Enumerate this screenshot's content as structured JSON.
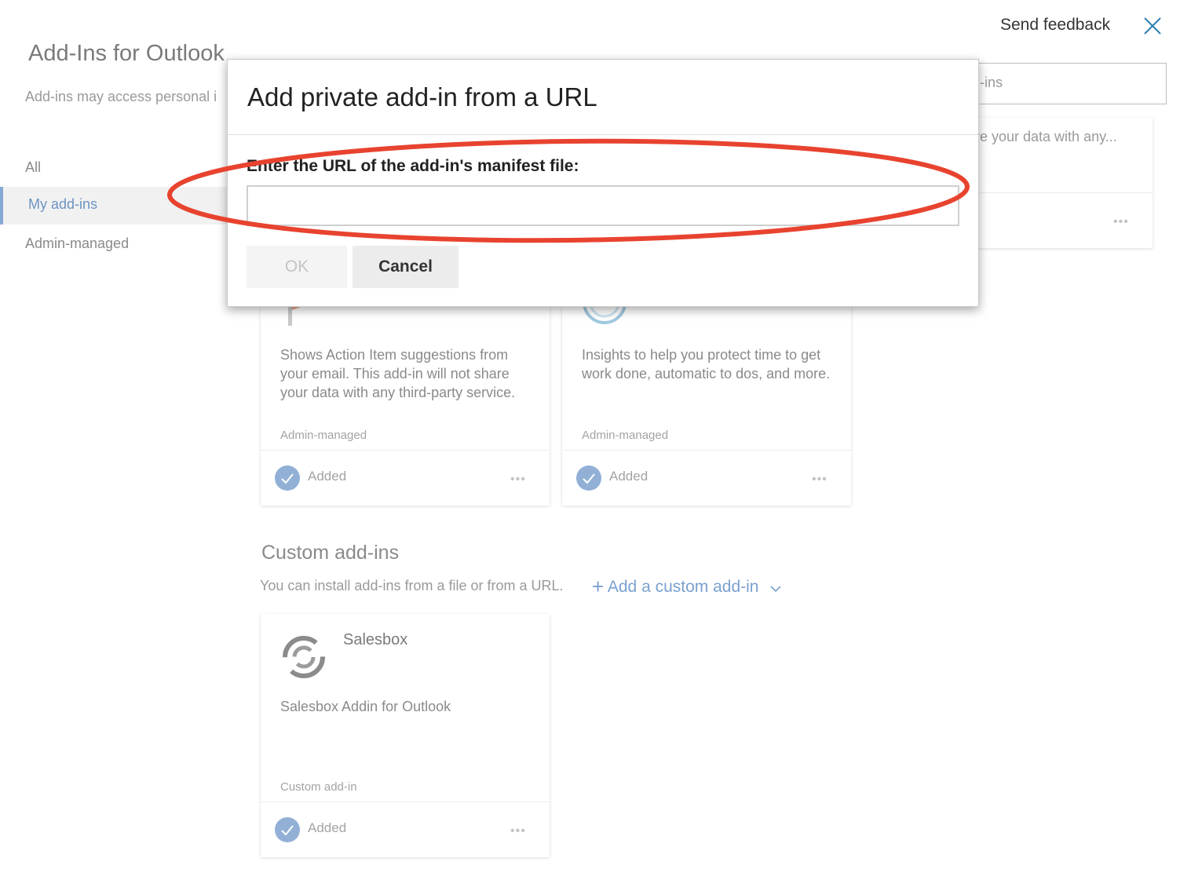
{
  "header": {
    "title": "Add-Ins for Outlook",
    "subtitle": "Add-ins may access personal i",
    "send_feedback": "Send feedback",
    "close_icon": "close-icon"
  },
  "search": {
    "placeholder_fragment": "-ins"
  },
  "sidebar": {
    "items": [
      {
        "label": "All"
      },
      {
        "label": "My add-ins",
        "selected": true
      },
      {
        "label": "Admin-managed"
      }
    ]
  },
  "top_right_card": {
    "desc_fragment": "re your data with any..."
  },
  "cards": [
    {
      "description": "Shows Action Item suggestions from your email. This add-in will not share your data with any third-party service.",
      "tag": "Admin-managed",
      "status": "Added"
    },
    {
      "description": "Insights to help you protect time to get work done, automatic to dos, and more.",
      "tag": "Admin-managed",
      "status": "Added"
    }
  ],
  "custom_section": {
    "title": "Custom add-ins",
    "subtitle": "You can install add-ins from a file or from a URL.",
    "add_link": "Add a custom add-in",
    "card": {
      "name": "Salesbox",
      "description": "Salesbox Addin for Outlook",
      "tag": "Custom add-in",
      "status": "Added"
    }
  },
  "dialog": {
    "title": "Add private add-in from a URL",
    "label": "Enter the URL of the add-in's manifest file:",
    "input_value": "",
    "ok_label": "OK",
    "cancel_label": "Cancel"
  },
  "colors": {
    "accent": "#6d93c2",
    "annotation": "#e8432f",
    "check": "#92b0d6"
  }
}
